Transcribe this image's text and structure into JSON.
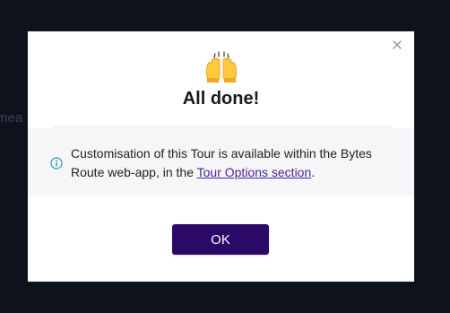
{
  "background": {
    "partial_text": "mea"
  },
  "modal": {
    "close_icon": "close-icon",
    "celebrate_icon": "raising-hands-icon",
    "title": "All done!",
    "info": {
      "icon": "info-icon",
      "text_before_link": "Customisation of this Tour is available within the Bytes Route web-app, in the ",
      "link_text": "Tour Options section",
      "text_after_link": "."
    },
    "ok_label": "OK"
  },
  "colors": {
    "backdrop": "#0d121c",
    "button": "#2a0a66",
    "link": "#4a1f9c",
    "info_icon": "#2a9bb0",
    "info_box_bg": "#f6f6f8"
  }
}
